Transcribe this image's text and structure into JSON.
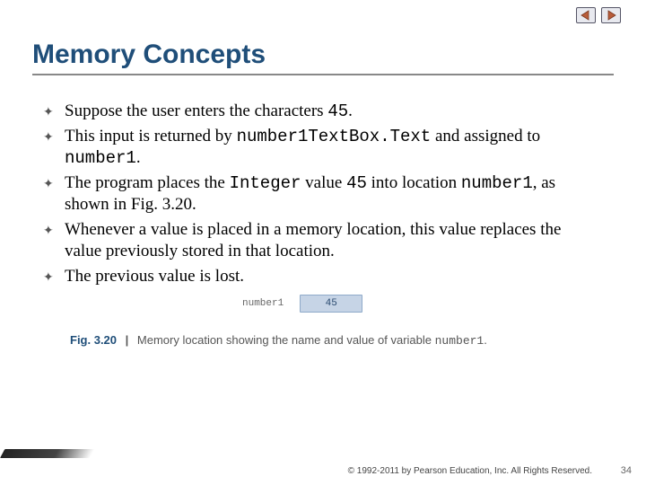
{
  "nav": {
    "prev_icon": "prev-triangle-icon",
    "next_icon": "next-triangle-icon"
  },
  "title": "Memory Concepts",
  "bullets": [
    {
      "pre": "Suppose the user enters the characters ",
      "code1": "45",
      "post": "."
    },
    {
      "pre": "This input is returned by ",
      "code1": "number1TextBox.Text",
      "mid": " and assigned to ",
      "code2": "number1",
      "post": "."
    },
    {
      "pre": "The program places the ",
      "code1": "Integer",
      "mid": " value ",
      "code2": "45",
      "mid2": " into location ",
      "code3": "number1",
      "post": ", as shown in Fig. 3.20."
    },
    {
      "pre": "Whenever a value is placed in a memory location, this value replaces the value previously stored in that location."
    },
    {
      "pre": "The previous value is lost."
    }
  ],
  "figure": {
    "label": "number1",
    "value": "45"
  },
  "caption": {
    "fignum": "Fig. 3.20",
    "bar": "|",
    "text_a": "Memory location showing the name and value of variable ",
    "code": "number1",
    "text_b": "."
  },
  "copyright": "© 1992-2011 by Pearson Education, Inc. All Rights Reserved.",
  "pagenum": "34"
}
